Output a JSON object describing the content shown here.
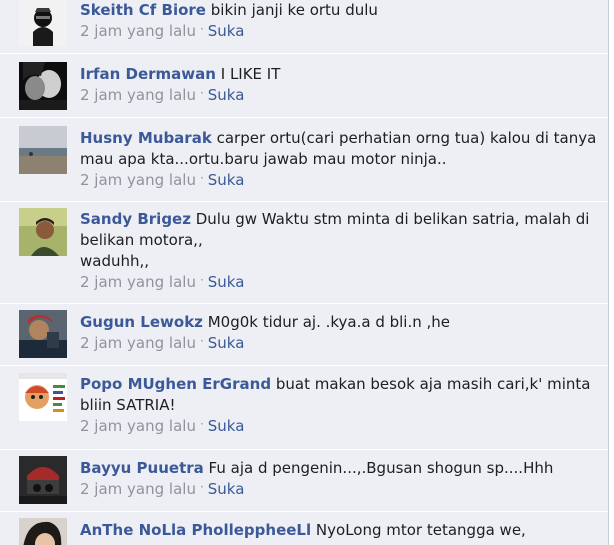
{
  "comments": [
    {
      "name": "Skeith Cf Biore",
      "text": "bikin janji ke ortu dulu",
      "time": "2 jam yang lalu",
      "separator": "·",
      "like": "Suka"
    },
    {
      "name": "Irfan Dermawan",
      "text": "I LIKE IT",
      "time": "2 jam yang lalu",
      "separator": "·",
      "like": "Suka"
    },
    {
      "name": "Husny Mubarak",
      "text": "carper ortu(cari perhatian orng tua) kalou di tanya mau apa kta...ortu.baru jawab mau motor ninja..",
      "time": "2 jam yang lalu",
      "separator": "·",
      "like": "Suka"
    },
    {
      "name": "Sandy Brigez",
      "text": "Dulu gw Waktu stm minta di belikan satria, malah di belikan motora,,\nwaduhh,,",
      "time": "2 jam yang lalu",
      "separator": "·",
      "like": "Suka"
    },
    {
      "name": "Gugun Lewokz",
      "text": "M0g0k tidur aj. .kya.a d bli.n ,he",
      "time": "2 jam yang lalu",
      "separator": "·",
      "like": "Suka"
    },
    {
      "name": "Popo MUghen ErGrand",
      "text": "buat makan besok aja masih cari,k' minta bliin SATRIA!",
      "time": "2 jam yang lalu",
      "separator": "·",
      "like": "Suka"
    },
    {
      "name": "Bayyu Puuetra",
      "text": "Fu aja d pengenin...,.Bgusan shogun sp....Hhh",
      "time": "2 jam yang lalu",
      "separator": "·",
      "like": "Suka"
    },
    {
      "name": "AnThe NoLla PholleppheeLl",
      "text": "NyoLong mtor tetangga we,",
      "time": "",
      "separator": "",
      "like": ""
    }
  ],
  "avatars": {
    "colors": {
      "blue": "#3b5998",
      "meta_gray": "#8f949b",
      "panel_bg": "#edeff4"
    }
  }
}
